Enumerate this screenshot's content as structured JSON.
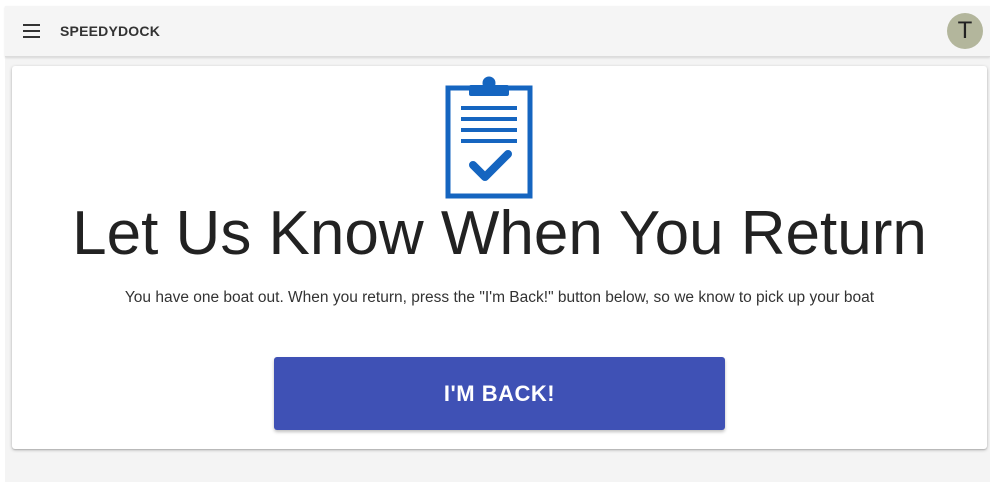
{
  "app_bar": {
    "brand": "SPEEDYDOCK",
    "menu_icon": "hamburger-menu-icon",
    "avatar_initial": "T",
    "avatar_color": "#b3b69c"
  },
  "main": {
    "icon": "clipboard-check-icon",
    "icon_color": "#1565c0",
    "title": "Let Us Know When You Return",
    "description": "You have one boat out. When you return, press the \"I'm Back!\" button below, so we know to pick up your boat",
    "button_label": "I'M BACK!",
    "button_color": "#3f51b5"
  }
}
